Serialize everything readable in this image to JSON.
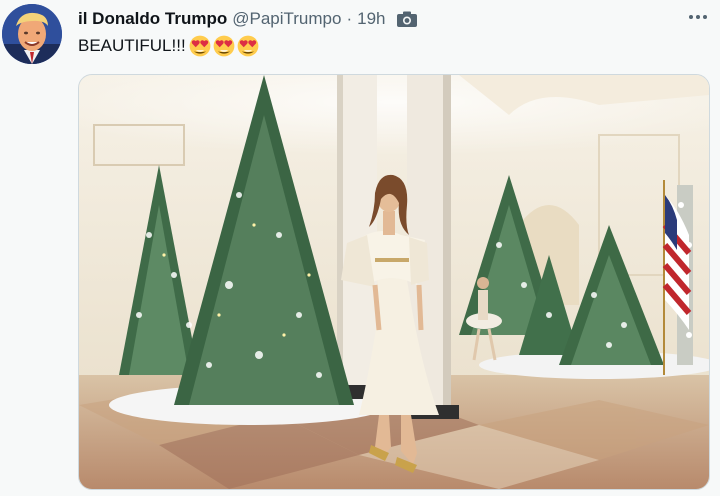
{
  "tweet": {
    "author_name": "il Donaldo Trumpo",
    "handle": "@PapiTrumpo",
    "separator": "·",
    "time": "19h",
    "text": "BEAUTIFUL!!!",
    "emoji": [
      "heart-eyes-emoji",
      "heart-eyes-emoji",
      "heart-eyes-emoji"
    ],
    "media_icon": "camera-icon",
    "more_icon": "more-dots-icon"
  },
  "colors": {
    "handle_gray": "#536471",
    "text": "#0f1419",
    "background": "#f7f9f9",
    "emoji_yellow": "#ffcc4d",
    "emoji_heart": "#dd2e44"
  }
}
